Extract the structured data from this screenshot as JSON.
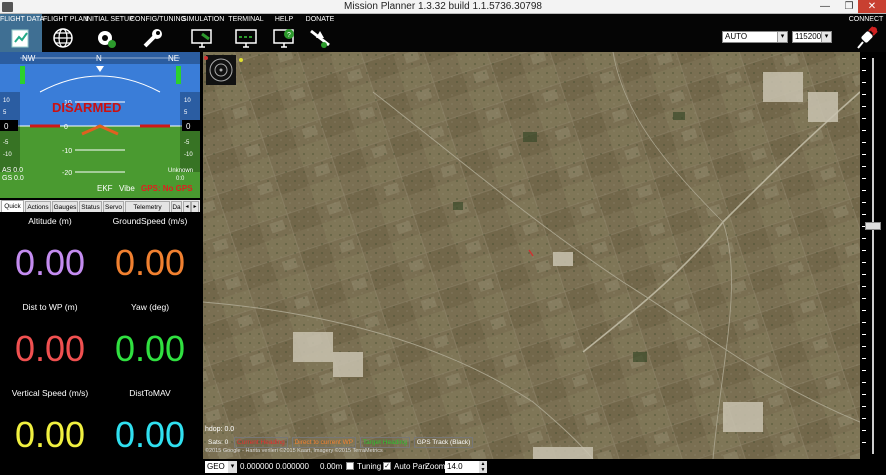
{
  "window": {
    "title": "Mission Planner 1.3.32 build 1.1.5736.30798",
    "minimize": "—",
    "maximize": "❐",
    "close": "✕"
  },
  "menu": [
    {
      "label": "FLIGHT DATA",
      "icon": "flight-data-icon"
    },
    {
      "label": "FLIGHT PLAN",
      "icon": "globe-icon"
    },
    {
      "label": "INITIAL SETUP",
      "icon": "setup-gear-icon"
    },
    {
      "label": "CONFIG/TUNING",
      "icon": "wrench-icon"
    },
    {
      "label": "SIMULATION",
      "icon": "simulation-icon"
    },
    {
      "label": "TERMINAL",
      "icon": "terminal-icon"
    },
    {
      "label": "HELP",
      "icon": "help-icon"
    },
    {
      "label": "DONATE",
      "icon": "donate-plane-icon"
    }
  ],
  "connection": {
    "port": "AUTO",
    "baud": "115200",
    "connect_label": "CONNECT"
  },
  "hud": {
    "status": "DISARMED",
    "ekf": "EKF",
    "vibe": "Vibe",
    "gps": "GPS: No GPS",
    "as": "AS 0.0",
    "gs": "GS 0.0",
    "unknown": "Unknown",
    "time": "0:0",
    "heading_ticks": [
      "NW",
      "N",
      "NE"
    ],
    "pitch_labels": [
      "10",
      "0",
      "-10",
      "-20"
    ],
    "left_ticks": [
      "10",
      "5",
      "0",
      "-5",
      "-10"
    ],
    "right_ticks": [
      "10",
      "5",
      "0",
      "-5",
      "-10"
    ],
    "alt_value": "0",
    "speed_value": "0",
    "colors": {
      "sky": "#3a7dd8",
      "ground": "#4a9a30",
      "armed": "#cc1010"
    }
  },
  "tabs": [
    "Quick",
    "Actions",
    "Gauges",
    "Status",
    "Servo",
    "Telemetry Logs",
    "Da"
  ],
  "quick": [
    {
      "label": "Altitude (m)",
      "value": "0.00",
      "color": "#c48cf0"
    },
    {
      "label": "GroundSpeed (m/s)",
      "value": "0.00",
      "color": "#f08030"
    },
    {
      "label": "Dist to WP (m)",
      "value": "0.00",
      "color": "#f05050"
    },
    {
      "label": "Yaw (deg)",
      "value": "0.00",
      "color": "#30e040"
    },
    {
      "label": "Vertical Speed (m/s)",
      "value": "0.00",
      "color": "#f0f040"
    },
    {
      "label": "DistToMAV",
      "value": "0.00",
      "color": "#30e0f0"
    }
  ],
  "map": {
    "hdop": "hdop: 0.0",
    "sats": "Sats: 0",
    "legend": [
      {
        "label": "Current Heading",
        "color": "#e03030"
      },
      {
        "label": "Direct to current WP",
        "color": "#f08030"
      },
      {
        "label": "Target Heading",
        "color": "#30c030"
      },
      {
        "label": "GPS Track (Black)",
        "color": "#ffffff"
      }
    ],
    "copyright": "©2015 Google - Harita verileri ©2015 Kaart, Imagery ©2015 TerraMetrics"
  },
  "bottom": {
    "coord_mode": "GEO",
    "coords": "0.000000 0.000000",
    "alt": "0.00m",
    "tuning_label": "Tuning",
    "tuning_checked": false,
    "autopan_label": "Auto Pan",
    "autopan_checked": true,
    "zoom_label": "Zoom",
    "zoom_value": "14.0"
  }
}
